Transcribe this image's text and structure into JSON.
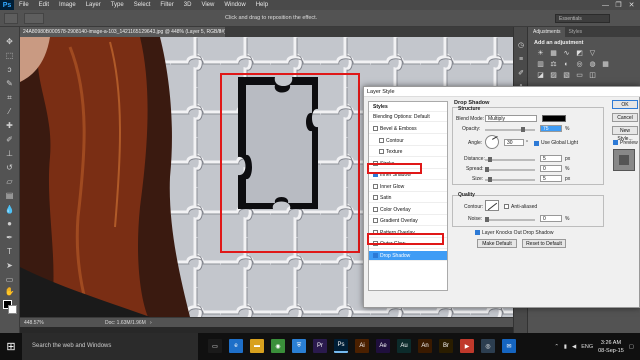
{
  "app": {
    "logo": "Ps"
  },
  "menu": [
    "File",
    "Edit",
    "Image",
    "Layer",
    "Type",
    "Select",
    "Filter",
    "3D",
    "View",
    "Window",
    "Help"
  ],
  "window_controls": {
    "minimize": "—",
    "maximize": "❐",
    "close": "✕"
  },
  "options_bar": {
    "hint": "Click and drag to reposition the effect.",
    "workspace": "Essentials"
  },
  "document": {
    "tab_title": "24A80980B000578-2908140-image-a-103_1421165129643.jpg @ 448% (Layer 5, RGB/8#)",
    "tab_close": "×"
  },
  "statusbar": {
    "zoom": "448.57%",
    "doc": "Doc: 1.63M/1.96M",
    "arrow": "›"
  },
  "right_panel": {
    "tabs": [
      "Adjustments",
      "Styles"
    ],
    "add_adjustment": "Add an adjustment"
  },
  "dialog": {
    "title": "Layer Style",
    "styles_header": "Styles",
    "blending_options": "Blending Options: Default",
    "styles": [
      {
        "label": "Bevel & Emboss",
        "checked": false,
        "sub": false,
        "selected": false
      },
      {
        "label": "Contour",
        "checked": false,
        "sub": true,
        "selected": false
      },
      {
        "label": "Texture",
        "checked": false,
        "sub": true,
        "selected": false
      },
      {
        "label": "Stroke",
        "checked": false,
        "sub": false,
        "selected": false
      },
      {
        "label": "Inner Shadow",
        "checked": true,
        "sub": false,
        "selected": false
      },
      {
        "label": "Inner Glow",
        "checked": false,
        "sub": false,
        "selected": false
      },
      {
        "label": "Satin",
        "checked": false,
        "sub": false,
        "selected": false
      },
      {
        "label": "Color Overlay",
        "checked": false,
        "sub": false,
        "selected": false
      },
      {
        "label": "Gradient Overlay",
        "checked": false,
        "sub": false,
        "selected": false
      },
      {
        "label": "Pattern Overlay",
        "checked": false,
        "sub": false,
        "selected": false
      },
      {
        "label": "Outer Glow",
        "checked": false,
        "sub": false,
        "selected": false
      },
      {
        "label": "Drop Shadow",
        "checked": true,
        "sub": false,
        "selected": true
      }
    ],
    "section_title": "Drop Shadow",
    "structure_title": "Structure",
    "blend_mode_label": "Blend Mode:",
    "blend_mode_value": "Multiply",
    "opacity_label": "Opacity:",
    "opacity_value": "75",
    "opacity_unit": "%",
    "angle_label": "Angle:",
    "angle_value": "30",
    "angle_unit": "°",
    "global_light_label": "Use Global Light",
    "distance_label": "Distance:",
    "distance_value": "5",
    "distance_unit": "px",
    "spread_label": "Spread:",
    "spread_value": "0",
    "spread_unit": "%",
    "size_label": "Size:",
    "size_value": "5",
    "size_unit": "px",
    "quality_title": "Quality",
    "contour_label": "Contour:",
    "anti_aliased_label": "Anti-aliased",
    "noise_label": "Noise:",
    "noise_value": "0",
    "noise_unit": "%",
    "knockout_label": "Layer Knocks Out Drop Shadow",
    "make_default": "Make Default",
    "reset_default": "Reset to Default",
    "ok": "OK",
    "cancel": "Cancel",
    "new_style": "New Style...",
    "preview_label": "Preview"
  },
  "taskbar": {
    "search": "Search the web and Windows",
    "apps": [
      {
        "label": "▭",
        "color": "#1a1a1a"
      },
      {
        "label": "e",
        "color": "#1e6fc8"
      },
      {
        "label": "▬",
        "color": "#d8a11e"
      },
      {
        "label": "◉",
        "color": "#3a8f3a"
      },
      {
        "label": "⛨",
        "color": "#2a7fd4"
      },
      {
        "label": "Pr",
        "color": "#2a1a4d"
      },
      {
        "label": "Ps",
        "color": "#001e36"
      },
      {
        "label": "Ai",
        "color": "#4b2000"
      },
      {
        "label": "Ae",
        "color": "#1f0f3d"
      },
      {
        "label": "Au",
        "color": "#0c2b2b"
      },
      {
        "label": "An",
        "color": "#3a1a00"
      },
      {
        "label": "Br",
        "color": "#2a1d00"
      },
      {
        "label": "▶",
        "color": "#c0392b"
      },
      {
        "label": "◎",
        "color": "#2c3e50"
      },
      {
        "label": "✉",
        "color": "#1565c0"
      }
    ],
    "tray_lang": "ENG",
    "time": "3:26 AM",
    "date": "08-Sep-15"
  }
}
